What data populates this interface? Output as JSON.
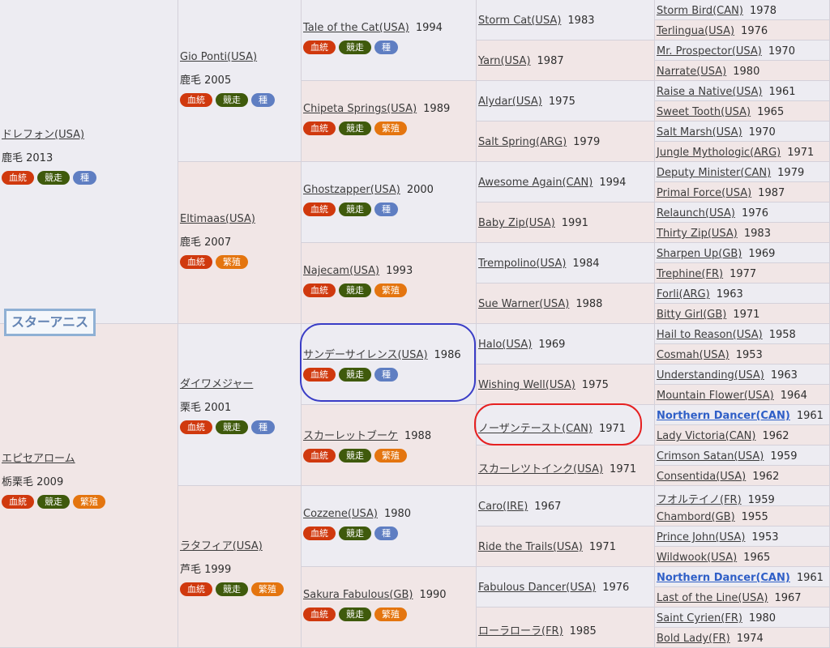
{
  "horse_label": "スターアニス",
  "badges": {
    "blood": "血統",
    "race": "競走",
    "sire": "種",
    "breed": "繁殖"
  },
  "gen1": [
    {
      "name": "ドレフォン(USA)",
      "coat": "鹿毛 2013",
      "badges": [
        "blood",
        "race",
        "sire"
      ]
    },
    {
      "name": "エピセアローム",
      "coat": "栃栗毛 2009",
      "badges": [
        "blood",
        "race",
        "breed"
      ]
    }
  ],
  "gen2": [
    {
      "name": "Gio Ponti(USA)",
      "coat": "鹿毛 2005",
      "badges": [
        "blood",
        "race",
        "sire"
      ]
    },
    {
      "name": "Eltimaas(USA)",
      "coat": "鹿毛 2007",
      "badges": [
        "blood",
        "breed"
      ]
    },
    {
      "name": "ダイワメジャー",
      "coat": "栗毛 2001",
      "badges": [
        "blood",
        "race",
        "sire"
      ]
    },
    {
      "name": "ラタフィア(USA)",
      "coat": "芦毛 1999",
      "badges": [
        "blood",
        "race",
        "breed"
      ]
    }
  ],
  "gen3": [
    {
      "name": "Tale of the Cat(USA)",
      "year": "1994",
      "badges": [
        "blood",
        "race",
        "sire"
      ]
    },
    {
      "name": "Chipeta Springs(USA)",
      "year": "1989",
      "badges": [
        "blood",
        "race",
        "breed"
      ]
    },
    {
      "name": "Ghostzapper(USA)",
      "year": "2000",
      "badges": [
        "blood",
        "race",
        "sire"
      ]
    },
    {
      "name": "Najecam(USA)",
      "year": "1993",
      "badges": [
        "blood",
        "race",
        "breed"
      ]
    },
    {
      "name": "サンデーサイレンス(USA)",
      "year": "1986",
      "badges": [
        "blood",
        "race",
        "sire"
      ]
    },
    {
      "name": "スカーレットブーケ",
      "year": "1988",
      "badges": [
        "blood",
        "race",
        "breed"
      ]
    },
    {
      "name": "Cozzene(USA)",
      "year": "1980",
      "badges": [
        "blood",
        "race",
        "sire"
      ]
    },
    {
      "name": "Sakura Fabulous(GB)",
      "year": "1990",
      "badges": [
        "blood",
        "race",
        "breed"
      ]
    }
  ],
  "gen4": [
    {
      "name": "Storm Cat(USA)",
      "year": "1983"
    },
    {
      "name": "Yarn(USA)",
      "year": "1987"
    },
    {
      "name": "Alydar(USA)",
      "year": "1975"
    },
    {
      "name": "Salt Spring(ARG)",
      "year": "1979"
    },
    {
      "name": "Awesome Again(CAN)",
      "year": "1994"
    },
    {
      "name": "Baby Zip(USA)",
      "year": "1991"
    },
    {
      "name": "Trempolino(USA)",
      "year": "1984"
    },
    {
      "name": "Sue Warner(USA)",
      "year": "1988"
    },
    {
      "name": "Halo(USA)",
      "year": "1969"
    },
    {
      "name": "Wishing Well(USA)",
      "year": "1975"
    },
    {
      "name": "ノーザンテースト(CAN)",
      "year": "1971"
    },
    {
      "name": "スカーレツトインク(USA)",
      "year": "1971"
    },
    {
      "name": "Caro(IRE)",
      "year": "1967"
    },
    {
      "name": "Ride the Trails(USA)",
      "year": "1971"
    },
    {
      "name": "Fabulous Dancer(USA)",
      "year": "1976"
    },
    {
      "name": "ローラローラ(FR)",
      "year": "1985"
    }
  ],
  "gen5": [
    {
      "name": "Storm Bird(CAN)",
      "year": "1978"
    },
    {
      "name": "Terlingua(USA)",
      "year": "1976"
    },
    {
      "name": "Mr. Prospector(USA)",
      "year": "1970"
    },
    {
      "name": "Narrate(USA)",
      "year": "1980"
    },
    {
      "name": "Raise a Native(USA)",
      "year": "1961"
    },
    {
      "name": "Sweet Tooth(USA)",
      "year": "1965"
    },
    {
      "name": "Salt Marsh(USA)",
      "year": "1970"
    },
    {
      "name": "Jungle Mythologic(ARG)",
      "year": "1971"
    },
    {
      "name": "Deputy Minister(CAN)",
      "year": "1979"
    },
    {
      "name": "Primal Force(USA)",
      "year": "1987"
    },
    {
      "name": "Relaunch(USA)",
      "year": "1976"
    },
    {
      "name": "Thirty Zip(USA)",
      "year": "1983"
    },
    {
      "name": "Sharpen Up(GB)",
      "year": "1969"
    },
    {
      "name": "Trephine(FR)",
      "year": "1977"
    },
    {
      "name": "Forli(ARG)",
      "year": "1963"
    },
    {
      "name": "Bitty Girl(GB)",
      "year": "1971"
    },
    {
      "name": "Hail to Reason(USA)",
      "year": "1958"
    },
    {
      "name": "Cosmah(USA)",
      "year": "1953"
    },
    {
      "name": "Understanding(USA)",
      "year": "1963"
    },
    {
      "name": "Mountain Flower(USA)",
      "year": "1964"
    },
    {
      "name": "Northern Dancer(CAN)",
      "year": "1961",
      "highlight": true
    },
    {
      "name": "Lady Victoria(CAN)",
      "year": "1962"
    },
    {
      "name": "Crimson Satan(USA)",
      "year": "1959"
    },
    {
      "name": "Consentida(USA)",
      "year": "1962"
    },
    {
      "name": "フオルテイノ(FR)",
      "year": "1959"
    },
    {
      "name": "Chambord(GB)",
      "year": "1955"
    },
    {
      "name": "Prince John(USA)",
      "year": "1953"
    },
    {
      "name": "Wildwook(USA)",
      "year": "1965"
    },
    {
      "name": "Northern Dancer(CAN)",
      "year": "1961",
      "highlight": true
    },
    {
      "name": "Last of the Line(USA)",
      "year": "1967"
    },
    {
      "name": "Saint Cyrien(FR)",
      "year": "1980"
    },
    {
      "name": "Bold Lady(FR)",
      "year": "1974"
    }
  ]
}
